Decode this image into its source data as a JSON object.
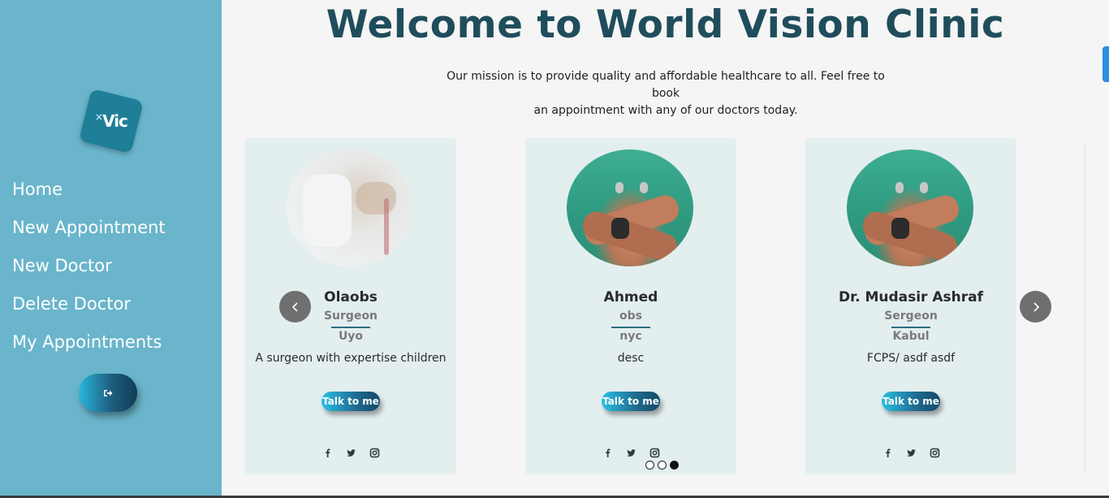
{
  "sidebar": {
    "logo_text": "Vic",
    "logo_mark": "×",
    "nav": [
      {
        "label": "Home"
      },
      {
        "label": "New Appointment"
      },
      {
        "label": "New Doctor"
      },
      {
        "label": "Delete Doctor"
      },
      {
        "label": "My Appointments"
      }
    ],
    "logout_icon": "sign-out-icon"
  },
  "header": {
    "title": "Welcome to World Vision Clinic",
    "mission_line1": "Our mission is to provide quality and affordable healthcare to all. Feel free to book",
    "mission_line2": "an appointment with any of our doctors today."
  },
  "doctors": [
    {
      "name": "Olaobs",
      "specialty": "Surgeon",
      "city": "Uyo",
      "description": "A surgeon with expertise children",
      "button": "Talk to me"
    },
    {
      "name": "Ahmed",
      "specialty": "obs",
      "city": "nyc",
      "description": "desc",
      "button": "Talk to me"
    },
    {
      "name": "Dr. Mudasir Ashraf",
      "specialty": "Sergeon",
      "city": "Kabul",
      "description": "FCPS/ asdf asdf",
      "button": "Talk to me"
    }
  ],
  "socials": [
    "facebook-icon",
    "twitter-icon",
    "instagram-icon"
  ],
  "carousel": {
    "pages": 3,
    "active_page": 3
  },
  "colors": {
    "sidebar_bg": "#6ab5cb",
    "title": "#1f4d5c",
    "card_bg": "#e3eeef",
    "button_gradient_start": "#2bbfe3",
    "button_gradient_end": "#154a66"
  }
}
